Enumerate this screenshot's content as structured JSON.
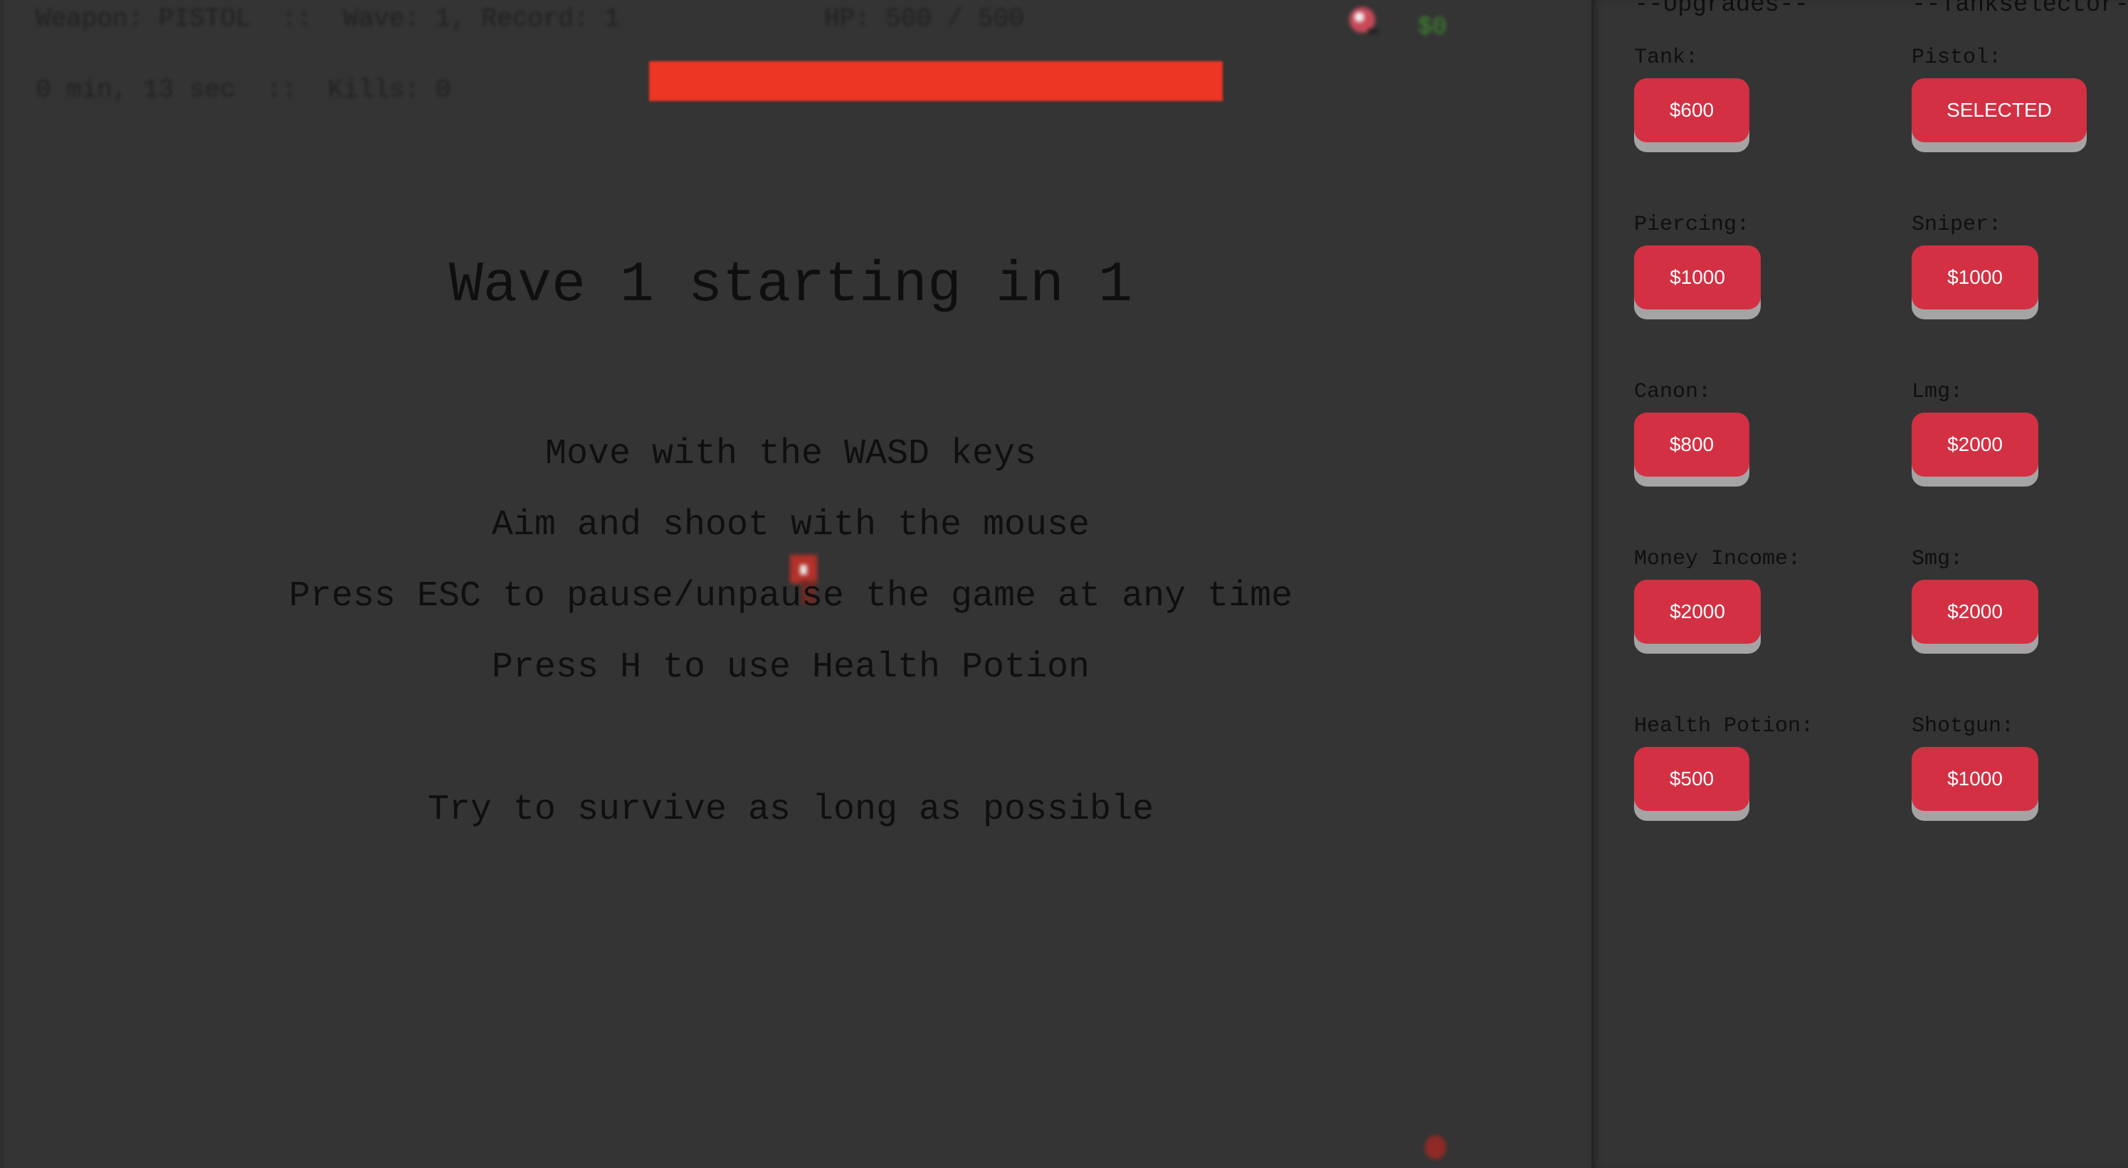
{
  "hud": {
    "status_line": "Weapon: PISTOL  ::  Wave: 1, Record: 1",
    "time_line": "0 min, 13 sec  ::  Kills: 0",
    "hp_text": "HP: 500 / 500",
    "hp_fraction": 1.0,
    "money": "$0"
  },
  "overlay": {
    "wave_countdown": "Wave 1 starting in 1",
    "instructions": [
      "Move with the WASD keys",
      "Aim and shoot with the mouse",
      "Press ESC to pause/unpause the game at any time",
      "Press H to use Health Potion",
      "Try to survive as long as possible"
    ]
  },
  "shop": {
    "upgrades_heading": "--Upgrades--",
    "tankselector_heading": "--Tankselector--",
    "upgrades": [
      {
        "label": "Tank:",
        "button": "$600"
      },
      {
        "label": "Piercing:",
        "button": "$1000"
      },
      {
        "label": "Canon:",
        "button": "$800"
      },
      {
        "label": "Money Income:",
        "button": "$2000"
      },
      {
        "label": "Health Potion:",
        "button": "$500"
      }
    ],
    "tanks": [
      {
        "label": "Pistol:",
        "button": "SELECTED"
      },
      {
        "label": "Sniper:",
        "button": "$1000"
      },
      {
        "label": "Lmg:",
        "button": "$2000"
      },
      {
        "label": "Smg:",
        "button": "$2000"
      },
      {
        "label": "Shotgun:",
        "button": "$1000"
      }
    ]
  },
  "colors": {
    "background": "#343434",
    "hp_bar": "#ee3624",
    "money_text": "#3d8f2c",
    "button": "#d33043",
    "button_shadow": "#a4a4a4"
  },
  "icons": {
    "player": "player-tank-icon",
    "center_sprite": "player-sprite-icon",
    "enemy": "enemy-dot-icon"
  }
}
